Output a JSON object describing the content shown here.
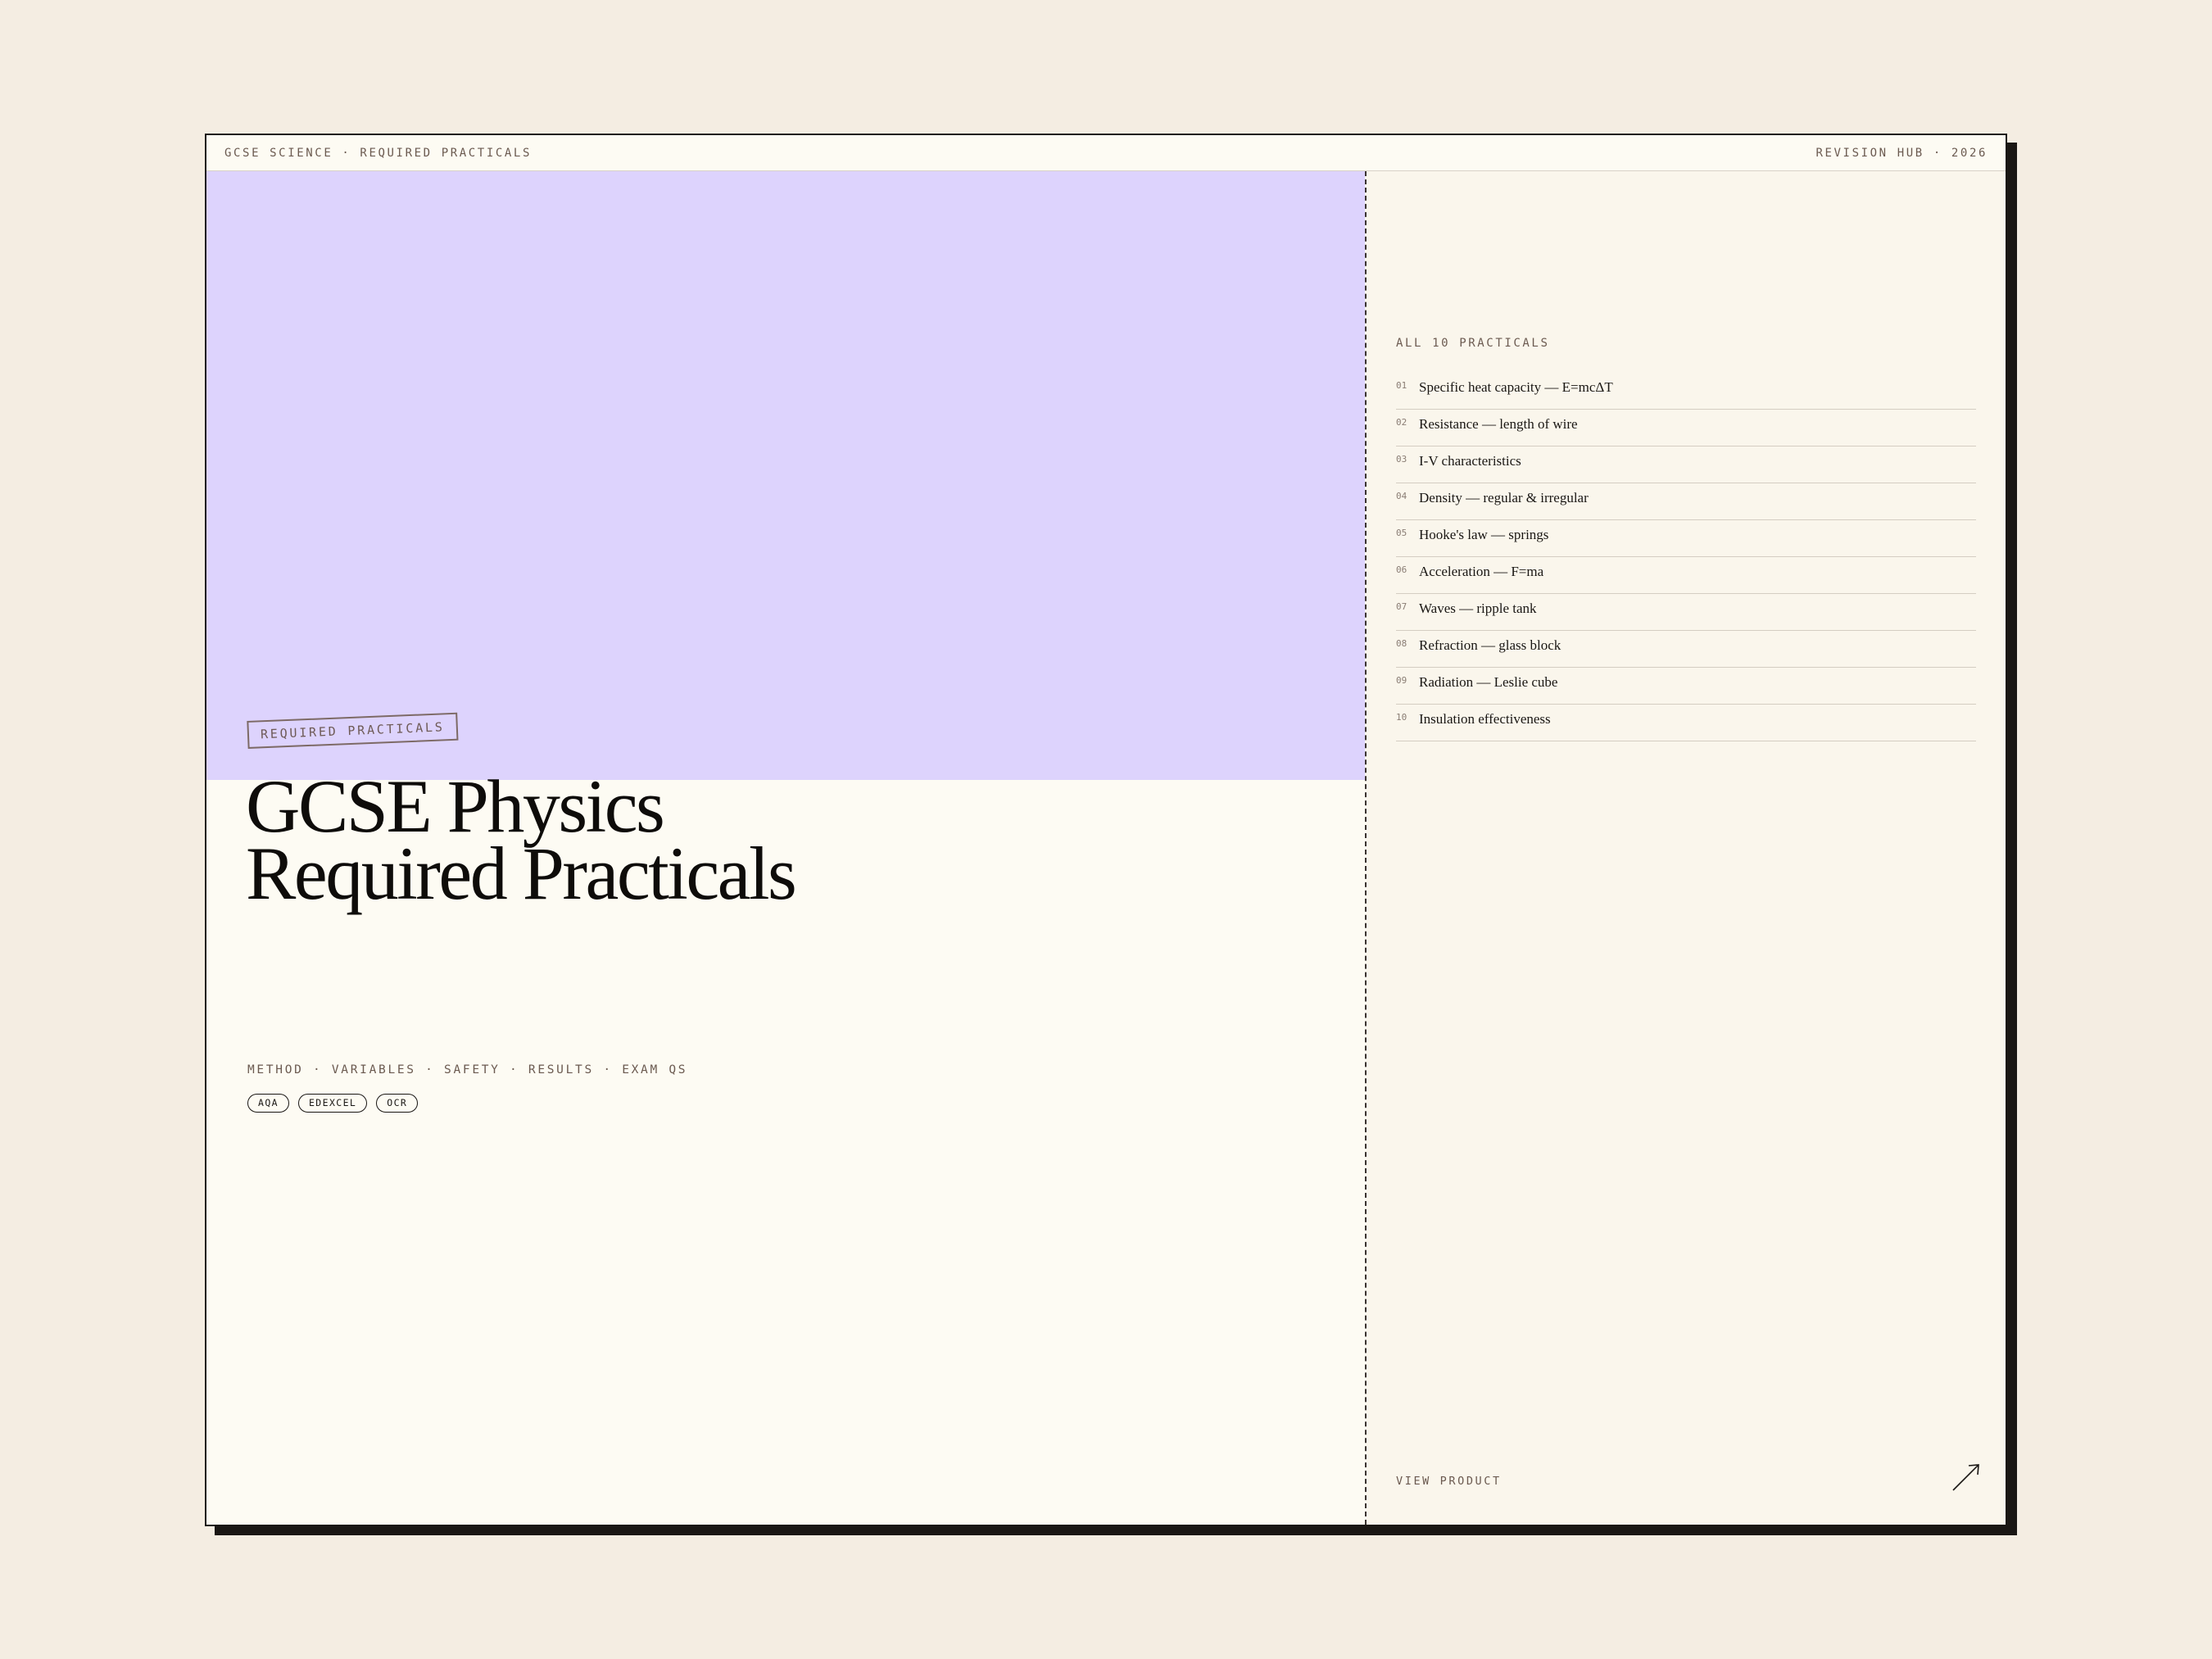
{
  "topbar": {
    "crumb": "GCSE SCIENCE · REQUIRED PRACTICALS",
    "hub": "REVISION HUB · 2026"
  },
  "hero": {
    "stamp": "REQUIRED PRACTICALS",
    "title_line1": "GCSE Physics",
    "title_line2": "Required Practicals",
    "subline": "METHOD · VARIABLES · SAFETY · RESULTS · EXAM QS",
    "badges": [
      "AQA",
      "EDEXCEL",
      "OCR"
    ],
    "panel_color": "#ddd3fd"
  },
  "sidebar": {
    "heading": "ALL 10 PRACTICALS",
    "items": [
      {
        "num": "01",
        "label": "Specific heat capacity — E=mcΔT"
      },
      {
        "num": "02",
        "label": "Resistance — length of wire"
      },
      {
        "num": "03",
        "label": "I-V characteristics"
      },
      {
        "num": "04",
        "label": "Density — regular & irregular"
      },
      {
        "num": "05",
        "label": "Hooke's law — springs"
      },
      {
        "num": "06",
        "label": "Acceleration — F=ma"
      },
      {
        "num": "07",
        "label": "Waves — ripple tank"
      },
      {
        "num": "08",
        "label": "Refraction — glass block"
      },
      {
        "num": "09",
        "label": "Radiation — Leslie cube"
      },
      {
        "num": "10",
        "label": "Insulation effectiveness"
      }
    ],
    "view_label": "VIEW PRODUCT",
    "arrow_icon": "arrow-up-right-icon"
  }
}
